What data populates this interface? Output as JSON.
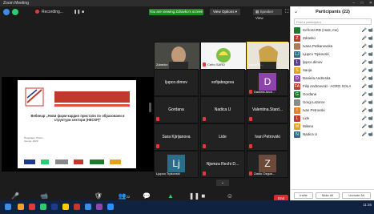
{
  "window": {
    "title": "Zoom Meeting"
  },
  "topbar": {
    "recording_label": "Recording...",
    "banner": "You are viewing Zdravko's screen",
    "view_options": "View Options",
    "speaker_view": "Speaker View"
  },
  "tiles": [
    {
      "label": "Zdravko",
      "kind": "photo"
    },
    {
      "label": "Cefro SARD",
      "kind": "logo"
    },
    {
      "label": "Ivana Fi...",
      "kind": "photo2"
    },
    {
      "label": "Daniela Andr...",
      "letter": "D",
      "kind": "avatar"
    },
    {
      "name": "ljupco.dimov",
      "kind": "text"
    },
    {
      "name": "sofijabogeva",
      "kind": "text"
    },
    {
      "name": "Gordana",
      "kind": "text"
    },
    {
      "name": "Nadica U",
      "kind": "text"
    },
    {
      "name": "Valentina.Stard...",
      "kind": "text"
    },
    {
      "name": "Sara Kjirijanova",
      "kind": "text"
    },
    {
      "name": "Lide",
      "kind": "text"
    },
    {
      "name": "Ivan Petrovski",
      "kind": "text"
    },
    {
      "name": "Lj",
      "label": "Ljupco Trpkovski",
      "kind": "avatar2"
    },
    {
      "name": "Njomza Rechi D...",
      "kind": "text"
    },
    {
      "name": "Z",
      "label": "Zarko Ozgun...",
      "kind": "avatar3"
    }
  ],
  "toolbar": {
    "unmute": "Unmute",
    "start_video": "Start Video",
    "security": "Security",
    "participants": "Participants",
    "participants_count": "22",
    "chat": "Chat",
    "share_screen": "Share Screen",
    "pause_recording": "Pause/Stop Recording",
    "reactions": "Reactions",
    "end": "End"
  },
  "panel": {
    "title": "Participants (22)",
    "search_placeholder": "Find a participant",
    "participants": [
      {
        "name": "CefroSARD  (Host, me)",
        "initial": "",
        "color": "#1f7a2e",
        "mic": "off",
        "cam": "off"
      },
      {
        "name": "Zdravko",
        "initial": "Z",
        "color": "#c0392b",
        "mic": "on",
        "cam": "on"
      },
      {
        "name": "Ivana Petkanovska",
        "initial": "",
        "color": "#b07a5a",
        "mic": "on",
        "cam": "on"
      },
      {
        "name": "Ljupco Trpkovski",
        "initial": "LJ",
        "color": "#2c6e8a",
        "mic": "off",
        "cam": "off"
      },
      {
        "name": "ljupco.dimov",
        "initial": "L",
        "color": "#5b3f9a",
        "mic": "on",
        "cam": "off"
      },
      {
        "name": "Sanja",
        "initial": "S",
        "color": "#e3a41c",
        "mic": "on",
        "cam": "off"
      },
      {
        "name": "Daniela Andreska",
        "initial": "D",
        "color": "#8e44ad",
        "mic": "off",
        "cam": "off"
      },
      {
        "name": "Filip Andreevski - AGRO SOLAR",
        "initial": "FA",
        "color": "#c0392b",
        "mic": "off",
        "cam": "off"
      },
      {
        "name": "Gordana",
        "initial": "G",
        "color": "#1f7a2e",
        "mic": "off",
        "cam": "off"
      },
      {
        "name": "Gorgi Lazarov",
        "initial": "",
        "color": "#8a8a8a",
        "mic": "off",
        "cam": "off"
      },
      {
        "name": "Ivan Petrovski",
        "initial": "I",
        "color": "#e67e22",
        "mic": "off",
        "cam": "off"
      },
      {
        "name": "Lide",
        "initial": "L",
        "color": "#c0392b",
        "mic": "off",
        "cam": "off"
      },
      {
        "name": "Milena",
        "initial": "M",
        "color": "#e3a41c",
        "mic": "off",
        "cam": "off"
      },
      {
        "name": "Nadica U",
        "initial": "N",
        "color": "#2c6e8a",
        "mic": "off",
        "cam": "off"
      }
    ],
    "invite": "Invite",
    "mute_all": "Mute All",
    "unmute_all": "Unmute All"
  },
  "taskbar": {
    "time": "11:36",
    "date": ""
  }
}
